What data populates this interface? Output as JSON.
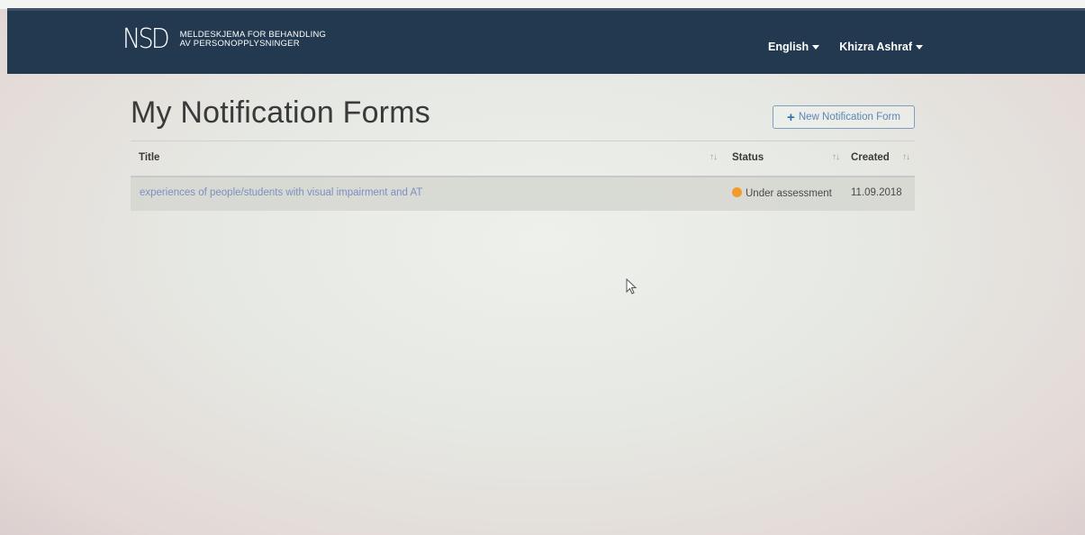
{
  "header": {
    "logo_text": "NSD",
    "brand_line1": "MELDESKJEMA FOR BEHANDLING",
    "brand_line2": "AV PERSONOPPLYSNINGER",
    "language_label": "English",
    "user_label": "Khizra Ashraf"
  },
  "main": {
    "title": "My Notification Forms",
    "new_button_label": "New Notification Form",
    "table": {
      "columns": [
        "Title",
        "Status",
        "Created"
      ],
      "rows": [
        {
          "title": "experiences of people/students with visual impairment and AT",
          "status": "Under assessment",
          "created": "11.09.2018"
        }
      ]
    }
  },
  "colors": {
    "navbar": "#22394f",
    "status_under_assessment": "#f29a2e",
    "link": "#7c8fc4"
  },
  "icons": [
    "plus-icon",
    "sort-icon",
    "caret-down-icon",
    "status-dot-icon",
    "mouse-cursor-icon"
  ]
}
